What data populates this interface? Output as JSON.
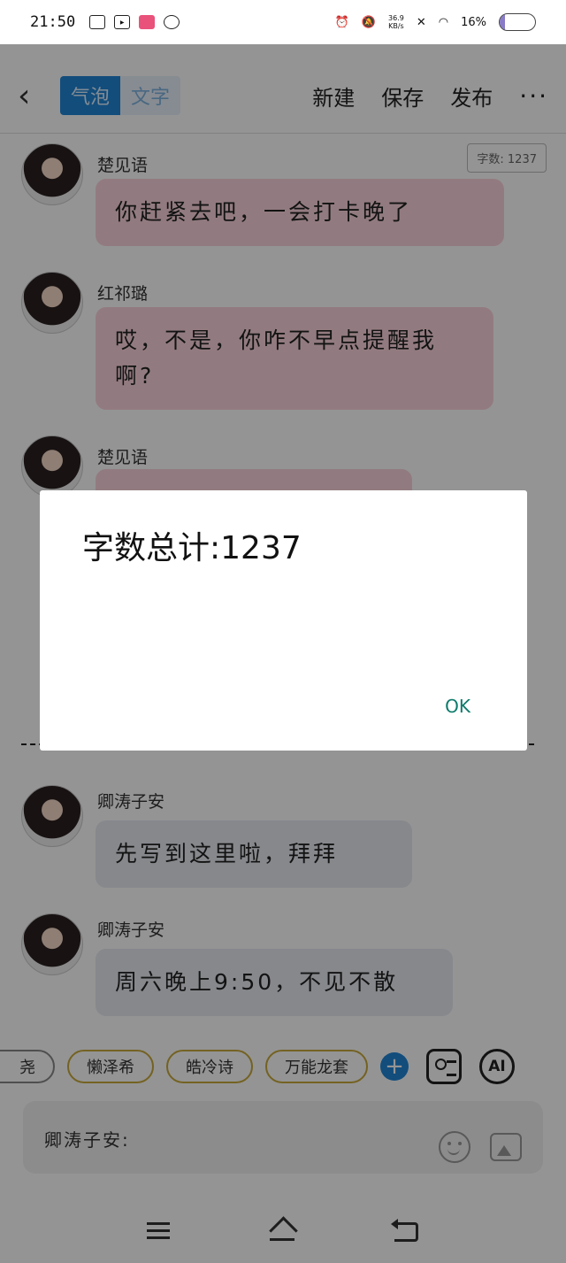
{
  "status_bar": {
    "time": "21:50",
    "net_speed_value": "36.9",
    "net_speed_unit": "KB/s",
    "battery": "16%",
    "battery_level": 0.16
  },
  "toolbar": {
    "mode_bubble": "气泡",
    "mode_text": "文字",
    "new_label": "新建",
    "save_label": "保存",
    "publish_label": "发布",
    "more_label": "···"
  },
  "chat": {
    "word_count_badge": "字数: 1237",
    "messages": [
      {
        "sender": "楚见语",
        "text": "你赶紧去吧，一会打卡晚了",
        "style": "pink"
      },
      {
        "sender": "红祁璐",
        "text": "哎，不是，你咋不早点提醒我啊?",
        "style": "pink"
      },
      {
        "sender": "楚见语",
        "text": "",
        "style": "pink"
      },
      {
        "sender": "卿涛子安",
        "text": "先写到这里啦，拜拜",
        "style": "grey"
      },
      {
        "sender": "卿涛子安",
        "text": "周六晚上9:50，不见不散",
        "style": "grey"
      }
    ]
  },
  "dialog": {
    "message": "字数总计:1237",
    "ok_label": "OK"
  },
  "chips": {
    "partial": "尧",
    "items": [
      "懒泽希",
      "皓冷诗",
      "万能龙套"
    ],
    "ai_label": "AI"
  },
  "input": {
    "current_role": "卿涛子安:"
  },
  "colors": {
    "accent": "#1f86d6",
    "bubble_pink": "#fbd5dc",
    "bubble_grey": "#e7ebf2",
    "ok_text": "#0d7b6b",
    "chip_border": "#c9a93b"
  }
}
